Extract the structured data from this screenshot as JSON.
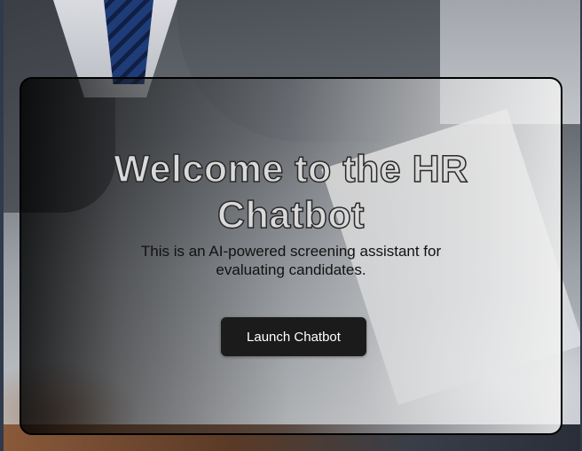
{
  "hero": {
    "title": "Welcome to the HR Chatbot",
    "subtitle": "This is an AI-powered screening assistant for evaluating candidates.",
    "button_label": "Launch Chatbot"
  },
  "colors": {
    "button_background": "#1b1b1b",
    "button_text": "#ffffff",
    "card_border": "#000000",
    "title_fill": "#d9d9d9"
  }
}
